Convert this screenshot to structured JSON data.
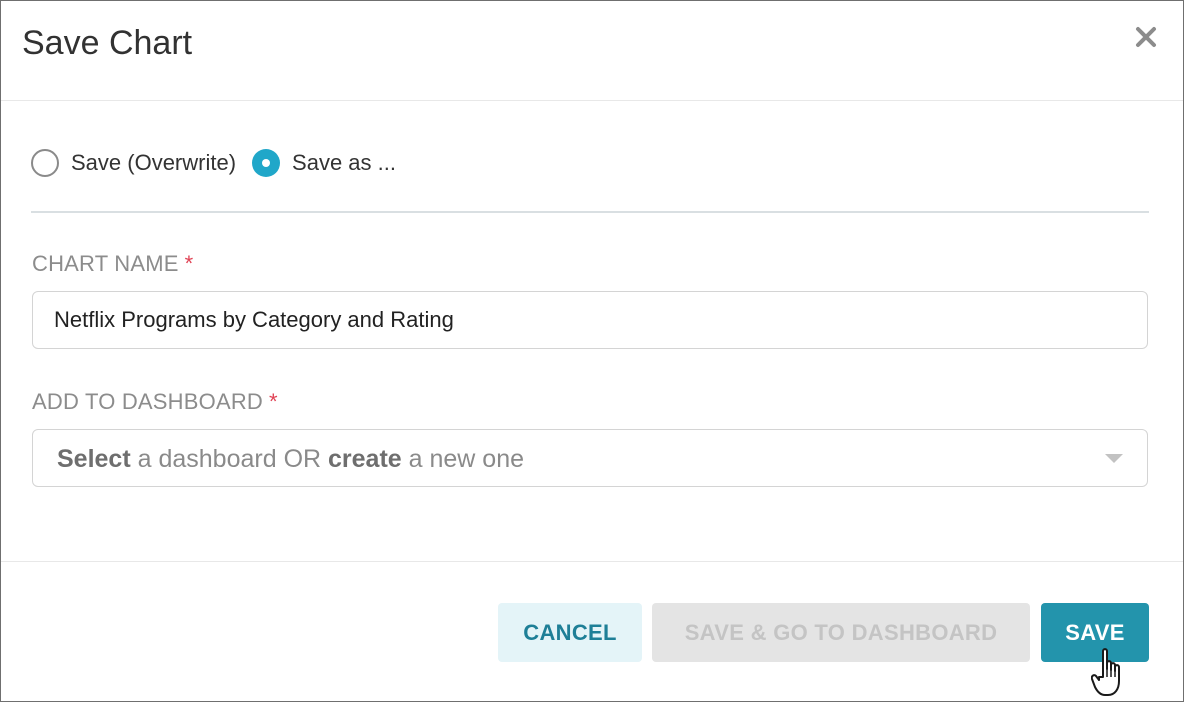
{
  "dialog": {
    "title": "Save Chart",
    "close_icon": "close-icon"
  },
  "save_mode": {
    "options": [
      {
        "label": "Save (Overwrite)",
        "checked": false
      },
      {
        "label": "Save as ...",
        "checked": true
      }
    ]
  },
  "chart_name": {
    "label": "CHART NAME",
    "required_mark": "*",
    "value": "Netflix Programs by Category and Rating"
  },
  "dashboard": {
    "label": "ADD TO DASHBOARD",
    "required_mark": "*",
    "placeholder_part1": "Select",
    "placeholder_part2": " a dashboard OR ",
    "placeholder_part3": "create",
    "placeholder_part4": " a new one",
    "caret_icon": "caret-down-icon"
  },
  "footer": {
    "cancel_label": "CANCEL",
    "save_goto_label": "SAVE & GO TO DASHBOARD",
    "save_label": "SAVE"
  },
  "colors": {
    "accent": "#20a7c9",
    "save_button": "#2394ac",
    "cancel_text": "#1e7f97",
    "required": "#e04355"
  }
}
